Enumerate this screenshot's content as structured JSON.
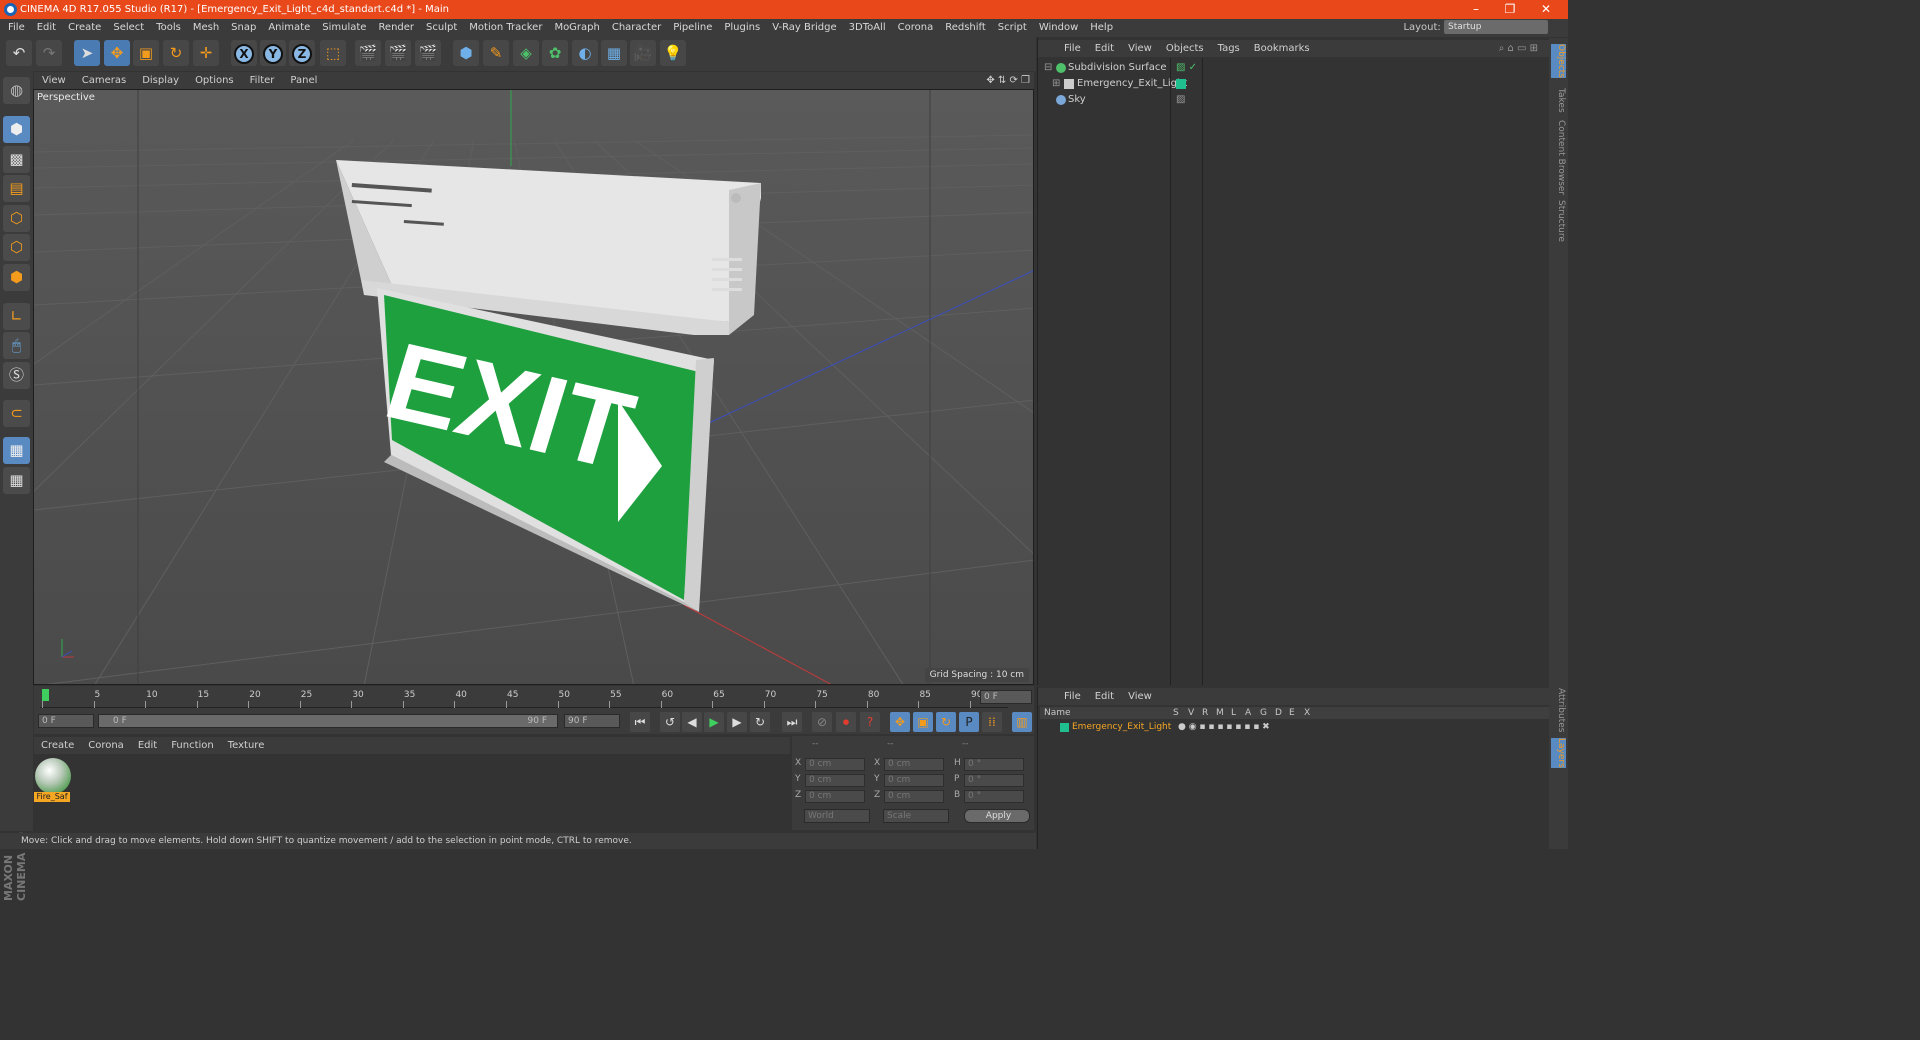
{
  "window": {
    "title": "CINEMA 4D R17.055 Studio (R17) - [Emergency_Exit_Light_c4d_standart.c4d *] - Main",
    "minimize": "–",
    "restore": "❐",
    "close": "✕"
  },
  "menubar": {
    "items": [
      "File",
      "Edit",
      "Create",
      "Select",
      "Tools",
      "Mesh",
      "Snap",
      "Animate",
      "Simulate",
      "Render",
      "Sculpt",
      "Motion Tracker",
      "MoGraph",
      "Character",
      "Pipeline",
      "Plugins",
      "V-Ray Bridge",
      "3DToAll",
      "Corona",
      "Redshift",
      "Script",
      "Window",
      "Help"
    ],
    "layout_label": "Layout:",
    "layout_value": "Startup"
  },
  "viewport": {
    "menu": [
      "View",
      "Cameras",
      "Display",
      "Options",
      "Filter",
      "Panel"
    ],
    "label": "Perspective",
    "grid_spacing": "Grid Spacing : 10 cm",
    "sign_text": "EXIT"
  },
  "timeline": {
    "ticks": [
      "0",
      "5",
      "10",
      "15",
      "20",
      "25",
      "30",
      "35",
      "40",
      "45",
      "50",
      "55",
      "60",
      "65",
      "70",
      "75",
      "80",
      "85",
      "90"
    ],
    "current_frame": "0 F"
  },
  "playbar": {
    "start_field": "0 F",
    "range_start": "0 F",
    "range_end": "90 F",
    "end_field": "90 F"
  },
  "material_manager": {
    "menu": [
      "Create",
      "Corona",
      "Edit",
      "Function",
      "Texture"
    ],
    "material_name": "Fire_Saf"
  },
  "coordinates": {
    "header": [
      "--",
      "--",
      "--"
    ],
    "rows": [
      {
        "l1": "X",
        "v1": "0 cm",
        "l2": "X",
        "v2": "0 cm",
        "l3": "H",
        "v3": "0 °"
      },
      {
        "l1": "Y",
        "v1": "0 cm",
        "l2": "Y",
        "v2": "0 cm",
        "l3": "P",
        "v3": "0 °"
      },
      {
        "l1": "Z",
        "v1": "0 cm",
        "l2": "Z",
        "v2": "0 cm",
        "l3": "B",
        "v3": "0 °"
      }
    ],
    "world": "World",
    "scale": "Scale",
    "apply": "Apply"
  },
  "status": "Move: Click and drag to move elements. Hold down SHIFT to quantize movement / add to the selection in point mode, CTRL to remove.",
  "object_manager": {
    "menu": [
      "File",
      "Edit",
      "View",
      "Objects",
      "Tags",
      "Bookmarks"
    ],
    "objects": [
      "Subdivision Surface",
      "Emergency_Exit_Light",
      "Sky"
    ]
  },
  "layer_manager": {
    "menu": [
      "File",
      "Edit",
      "View"
    ],
    "columns": [
      "Name",
      "S",
      "V",
      "R",
      "M",
      "L",
      "A",
      "G",
      "D",
      "E",
      "X"
    ],
    "layer": "Emergency_Exit_Light"
  },
  "side_tabs": [
    "Objects",
    "Takes",
    "Content Browser",
    "Structure",
    "Attributes",
    "Layers"
  ],
  "branding": "MAXON CINEMA 4D",
  "colors": {
    "title_bar": "#e8481a",
    "selection": "#4a7cb3",
    "sign_green": "#1fa03f",
    "accent_orange": "#f5a623"
  }
}
